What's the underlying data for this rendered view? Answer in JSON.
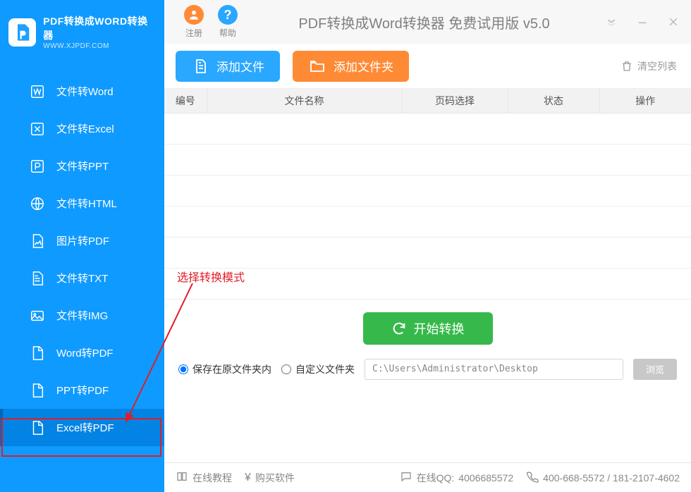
{
  "brand": {
    "title": "PDF转换成WORD转换器",
    "url": "WWW.XJPDF.COM"
  },
  "sidebar": {
    "items": [
      {
        "label": "文件转Word"
      },
      {
        "label": "文件转Excel"
      },
      {
        "label": "文件转PPT"
      },
      {
        "label": "文件转HTML"
      },
      {
        "label": "图片转PDF"
      },
      {
        "label": "文件转TXT"
      },
      {
        "label": "文件转IMG"
      },
      {
        "label": "Word转PDF"
      },
      {
        "label": "PPT转PDF"
      },
      {
        "label": "Excel转PDF"
      }
    ]
  },
  "topbar": {
    "register": "注册",
    "help": "帮助",
    "title": "PDF转换成Word转换器 免费试用版 v5.0"
  },
  "actions": {
    "add_file": "添加文件",
    "add_folder": "添加文件夹",
    "clear_list": "清空列表"
  },
  "table": {
    "cols": [
      "编号",
      "文件名称",
      "页码选择",
      "状态",
      "操作"
    ]
  },
  "annotation": "选择转换模式",
  "start": "开始转换",
  "save": {
    "opt_original": "保存在原文件夹内",
    "opt_custom": "自定义文件夹",
    "path": "C:\\Users\\Administrator\\Desktop",
    "browse": "浏览"
  },
  "footer": {
    "tutorial": "在线教程",
    "buy": "购买软件",
    "qq_label": "在线QQ:",
    "qq": "4006685572",
    "phone": "400-668-5572 / 181-2107-4602"
  }
}
